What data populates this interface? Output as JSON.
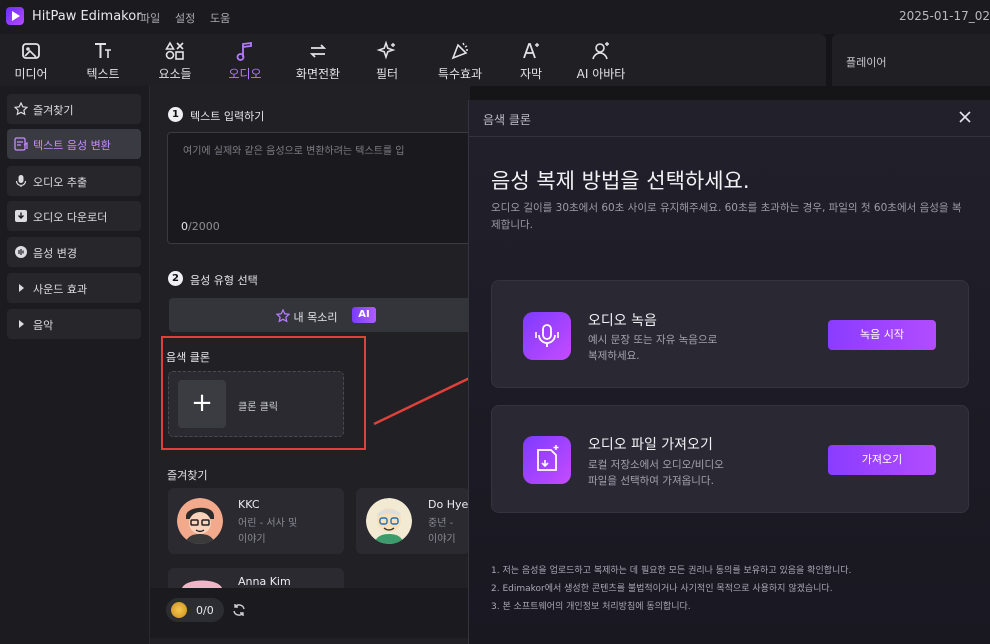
{
  "app": {
    "name": "HitPaw Edimakor",
    "menu": [
      "파일",
      "설정",
      "도움"
    ],
    "date": "2025-01-17_02"
  },
  "toolbar": {
    "items": [
      {
        "label": "미디어",
        "icon": "media-icon"
      },
      {
        "label": "텍스트",
        "icon": "text-icon"
      },
      {
        "label": "요소들",
        "icon": "elements-icon"
      },
      {
        "label": "오디오",
        "icon": "audio-icon",
        "active": true
      },
      {
        "label": "화면전환",
        "icon": "transition-icon"
      },
      {
        "label": "필터",
        "icon": "filter-icon"
      },
      {
        "label": "특수효과",
        "icon": "effects-icon"
      },
      {
        "label": "자막",
        "icon": "subtitle-icon"
      },
      {
        "label": "AI 아바타",
        "icon": "ai-avatar-icon"
      }
    ],
    "accent": "#b47bff"
  },
  "player": {
    "label": "플레이어"
  },
  "sidebar": {
    "items": [
      {
        "label": "즐겨찾기",
        "icon": "star-icon"
      },
      {
        "label": "텍스트 음성 변환",
        "icon": "text-to-speech-icon",
        "active": true
      },
      {
        "label": "오디오 추출",
        "icon": "microphone-icon"
      },
      {
        "label": "오디오 다운로더",
        "icon": "download-icon"
      },
      {
        "label": "음성 변경",
        "icon": "voice-change-icon"
      },
      {
        "label": "사운드 효과",
        "icon": "chevron-right-icon"
      },
      {
        "label": "음악",
        "icon": "chevron-right-icon"
      }
    ]
  },
  "main": {
    "step1": {
      "num": "1",
      "label": "텍스트 입력하기"
    },
    "textarea": {
      "placeholder": "여기에 실제와 같은 음성으로 변환하려는 텍스트를 입",
      "count": "0",
      "max": "/2000"
    },
    "step2": {
      "num": "2",
      "label": "음성 유형 선택"
    },
    "my_voice": {
      "label": "내 목소리",
      "badge": "AI"
    },
    "clone_section": {
      "label": "음색 클론",
      "button": "클론 클릭",
      "plus": "+"
    },
    "favorites_label": "즐겨찾기",
    "voices": [
      {
        "name": "KKC",
        "desc1": "어린 - 서사 및",
        "desc2": "이야기"
      },
      {
        "name": "Do Hye",
        "desc1": "중년 - ",
        "desc2": "이야기"
      },
      {
        "name": "Anna Kim",
        "desc1": "",
        "desc2": ""
      }
    ],
    "credits": "0/0"
  },
  "modal": {
    "title": "음색 클론",
    "heading": "음성 복제 방법을 선택하세요.",
    "description": "오디오 길이를 30초에서 60초 사이로 유지해주세요. 60초를 초과하는 경우, 파일의 첫 60초에서 음성을 복제합니다.",
    "options": [
      {
        "title": "오디오 녹음",
        "desc1": "예시 문장 또는 자유 녹음으로",
        "desc2": "복제하세요.",
        "button": "녹음 시작",
        "icon": "microphone-icon"
      },
      {
        "title": "오디오 파일 가져오기",
        "desc1": "로컬 저장소에서 오디오/비디오",
        "desc2": "파일을 선택하여 가져옵니다.",
        "button": "가져오기",
        "icon": "import-file-icon"
      }
    ],
    "notes": [
      "1. 저는 음성을 업로드하고 복제하는 데 필요한 모든 권리나 동의를 보유하고 있음을 확인합니다.",
      "2. Edimakor에서 생성한 콘텐츠를 불법적이거나 사기적인 목적으로 사용하지 않겠습니다.",
      "3. 본 소프트웨어의 개인정보 처리방침에 동의합니다."
    ]
  }
}
